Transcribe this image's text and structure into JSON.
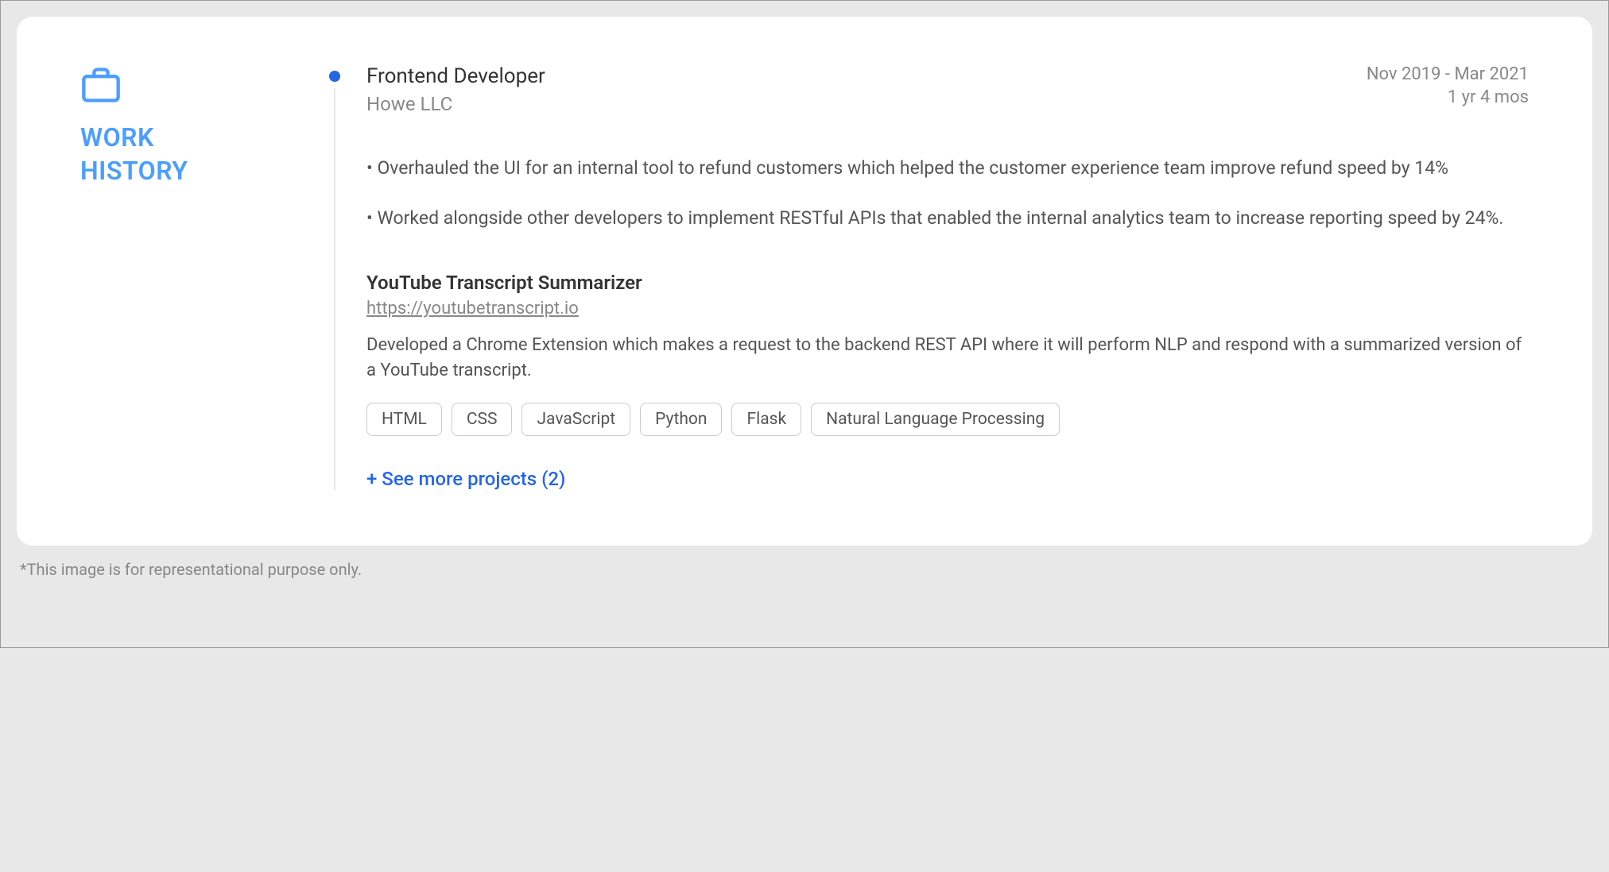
{
  "sidebar": {
    "title_line1": "WORK",
    "title_line2": "HISTORY"
  },
  "job": {
    "title": "Frontend Developer",
    "company": "Howe LLC",
    "date_range": "Nov 2019 - Mar 2021",
    "duration": "1 yr 4 mos",
    "bullets": [
      "• Overhauled the UI for an internal tool to refund customers which helped the customer experience team improve refund speed by 14%",
      "• Worked alongside other developers to implement RESTful APIs that enabled the internal analytics team to increase reporting speed by 24%."
    ]
  },
  "project": {
    "title": "YouTube Transcript Summarizer",
    "url": "https://youtubetranscript.io",
    "description": "Developed a Chrome Extension which makes a request to the backend REST API where it will perform NLP and respond with a summarized version of a YouTube transcript.",
    "tags": [
      "HTML",
      "CSS",
      "JavaScript",
      "Python",
      "Flask",
      "Natural Language Processing"
    ]
  },
  "see_more": "+ See more projects (2)",
  "disclaimer": "*This image is for representational purpose only."
}
